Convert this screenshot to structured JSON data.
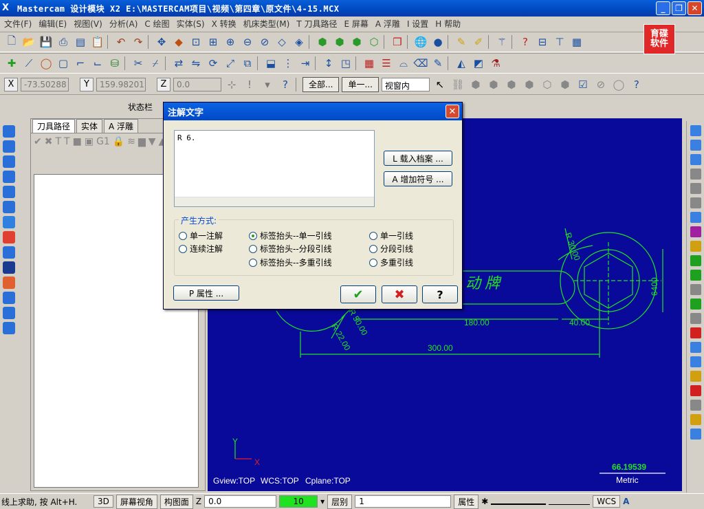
{
  "window": {
    "title": "Mastercam 设计模块  X2  E:\\MASTERCAM项目\\视频\\第四章\\原文件\\4-15.MCX",
    "app_icon": "X",
    "minimize": "_",
    "restore": "❐",
    "close": "✕"
  },
  "menu": [
    "文件(F)",
    "编辑(E)",
    "视图(V)",
    "分析(A)",
    "C 绘图",
    "实体(S)",
    "X 转换",
    "机床类型(M)",
    "T 刀具路径",
    "E 屏幕",
    "A 浮雕",
    "I 设置",
    "H 帮助"
  ],
  "logo": {
    "line1": "育碟",
    "line2": "软件"
  },
  "coords": {
    "x_label": "X",
    "x_value": "-73.50288",
    "y_label": "Y",
    "y_value": "159.98201",
    "z_label": "Z",
    "z_value": "0.0",
    "all_btn": "全部...",
    "single_btn": "单一...",
    "window_select": "视窗内"
  },
  "status_title": "状态栏",
  "panel": {
    "tabs": [
      "刀具路径",
      "实体",
      "A 浮雕"
    ]
  },
  "dialog": {
    "title": "注解文字",
    "close": "✕",
    "text_value": "R 6.",
    "load_btn": "L 载入档案 ...",
    "add_symbol_btn": "A 增加符号 ...",
    "group_label": "产生方式:",
    "radios": [
      {
        "label": "单一注解",
        "selected": false
      },
      {
        "label": "连续注解",
        "selected": false
      },
      {
        "label": "标签抬头--单一引线",
        "selected": true
      },
      {
        "label": "标签抬头--分段引线",
        "selected": false
      },
      {
        "label": "标签抬头--多重引线",
        "selected": false
      },
      {
        "label": "单一引线",
        "selected": false
      },
      {
        "label": "分段引线",
        "selected": false
      },
      {
        "label": "多重引线",
        "selected": false
      }
    ],
    "props_btn": "P 属性 ...",
    "ok_icon": "✔",
    "cancel_icon": "✖",
    "help_icon": "?"
  },
  "drawing": {
    "dims": [
      "R 30.00",
      "6400",
      "动  牌",
      "R 50.00",
      "R 22.00",
      "180.00",
      "40.00",
      "300.00"
    ],
    "gview": "Gview:TOP",
    "wcs": "WCS:TOP",
    "cplane": "Cplane:TOP",
    "axis_y": "Y",
    "axis_x": "X",
    "scale_value": "66.19539",
    "scale_unit": "Metric"
  },
  "bottom": {
    "help": "线上求助, 按 Alt+H.",
    "btn_3d": "3D",
    "screen_view": "屏幕视角",
    "construct_plane": "构图面",
    "z_label": "Z",
    "z_value": "0.0",
    "color_value": "10",
    "layer_label": "层别",
    "layer_value": "1",
    "attr": "属性",
    "wcs": "WCS"
  },
  "colors": {
    "viewport": "#0a0a9a",
    "drawing": "#21e221",
    "dialog_title": "#0b64e4"
  }
}
